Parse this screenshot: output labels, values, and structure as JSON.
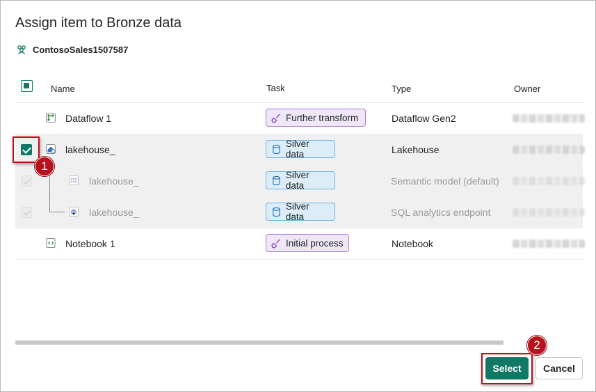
{
  "dialog": {
    "title": "Assign item to Bronze data",
    "workspace": "ContosoSales1507587"
  },
  "columns": {
    "name": "Name",
    "task": "Task",
    "type": "Type",
    "owner": "Owner"
  },
  "rows": [
    {
      "name": "Dataflow 1",
      "icon": "dataflow-icon",
      "task": "Further transform",
      "task_style": "purple",
      "task_icon": "broom-icon",
      "type": "Dataflow Gen2",
      "checked": false,
      "child": false
    },
    {
      "name": "lakehouse_",
      "icon": "lakehouse-icon",
      "task": "Silver data",
      "task_style": "silver",
      "task_icon": "database-icon",
      "type": "Lakehouse",
      "checked": true,
      "child": false
    },
    {
      "name": "lakehouse_",
      "icon": "semantic-model-icon",
      "task": "Silver data",
      "task_style": "silver",
      "task_icon": "database-icon",
      "type": "Semantic model (default)",
      "checked": true,
      "disabled": true,
      "child": true
    },
    {
      "name": "lakehouse_",
      "icon": "sql-endpoint-icon",
      "task": "Silver data",
      "task_style": "silver",
      "task_icon": "database-icon",
      "type": "SQL analytics endpoint",
      "checked": true,
      "disabled": true,
      "child": true
    },
    {
      "name": "Notebook 1",
      "icon": "notebook-icon",
      "task": "Initial process",
      "task_style": "purple",
      "task_icon": "broom-icon",
      "type": "Notebook",
      "checked": false,
      "child": false
    }
  ],
  "buttons": {
    "select": "Select",
    "cancel": "Cancel"
  },
  "annotations": {
    "step1": "1",
    "step2": "2"
  },
  "colors": {
    "accent": "#117865",
    "annotation": "#c0101a"
  }
}
